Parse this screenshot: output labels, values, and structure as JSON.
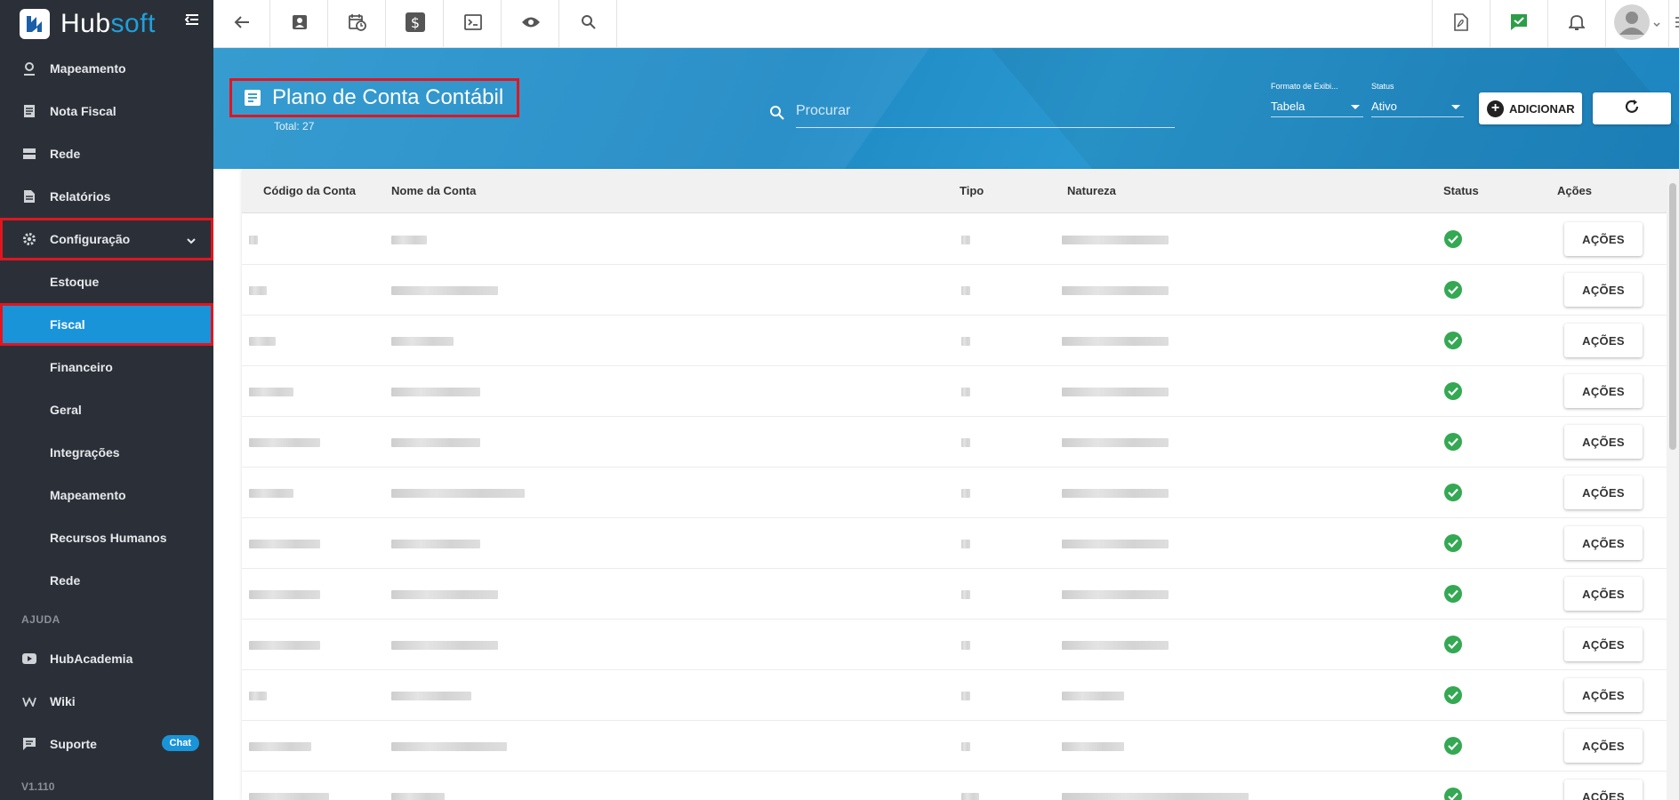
{
  "brand": {
    "name_part1": "Hub",
    "name_part2": "soft",
    "collapse_icon": "menu-collapse-icon"
  },
  "sidebar": {
    "items": [
      {
        "label": "Mapeamento",
        "icon": "map-pin-icon"
      },
      {
        "label": "Nota Fiscal",
        "icon": "document-icon"
      },
      {
        "label": "Rede",
        "icon": "server-icon"
      },
      {
        "label": "Relatórios",
        "icon": "report-icon"
      },
      {
        "label": "Configuração",
        "icon": "gear-icon"
      }
    ],
    "subitems": [
      {
        "label": "Estoque"
      },
      {
        "label": "Fiscal"
      },
      {
        "label": "Financeiro"
      },
      {
        "label": "Geral"
      },
      {
        "label": "Integrações"
      },
      {
        "label": "Mapeamento"
      },
      {
        "label": "Recursos Humanos"
      },
      {
        "label": "Rede"
      }
    ],
    "help_section": "AJUDA",
    "help_items": [
      {
        "label": "HubAcademia",
        "icon": "youtube-icon"
      },
      {
        "label": "Wiki",
        "icon": "wikipedia-icon"
      },
      {
        "label": "Suporte",
        "icon": "chat-icon"
      }
    ],
    "chat_badge": "Chat",
    "version": "V1.110"
  },
  "header": {
    "title": "Plano de Conta Contábil",
    "total": "Total: 27",
    "search_placeholder": "Procurar",
    "format_label": "Formato de Exibi...",
    "format_value": "Tabela",
    "status_label": "Status",
    "status_value": "Ativo",
    "add_label": "ADICIONAR"
  },
  "table": {
    "columns": [
      "Código da Conta",
      "Nome da Conta",
      "Tipo",
      "Natureza",
      "Status",
      "Ações"
    ],
    "action_label": "AÇÕES",
    "status_ok_color": "#34a853"
  },
  "colors": {
    "sidebar_bg": "#2b3038",
    "active": "#1a94d8",
    "banner": "#2590c9",
    "highlight": "#e2151f"
  }
}
